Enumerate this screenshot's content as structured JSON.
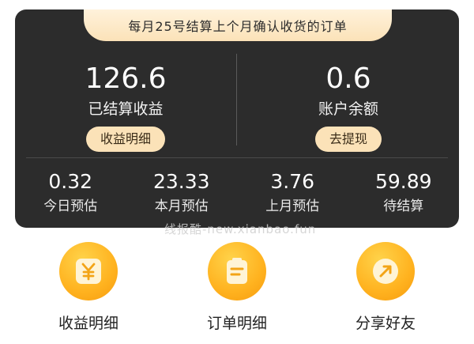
{
  "notice": "每月25号结算上个月确认收货的订单",
  "settled": {
    "value": "126.6",
    "label": "已结算收益",
    "button": "收益明细"
  },
  "balance": {
    "value": "0.6",
    "label": "账户余额",
    "button": "去提现"
  },
  "stats": [
    {
      "value": "0.32",
      "label": "今日预估"
    },
    {
      "value": "23.33",
      "label": "本月预估"
    },
    {
      "value": "3.76",
      "label": "上月预估"
    },
    {
      "value": "59.89",
      "label": "待结算"
    }
  ],
  "watermark": "线报酷-new.xianbao.fun",
  "actions": [
    {
      "label": "收益明细",
      "icon": "yen-icon"
    },
    {
      "label": "订单明细",
      "icon": "clipboard-icon"
    },
    {
      "label": "分享好友",
      "icon": "share-arrow-icon"
    }
  ],
  "colors": {
    "card": "#2c2c2c",
    "accent": "#fbe2b8",
    "icon_gold": "#ffb21f"
  }
}
